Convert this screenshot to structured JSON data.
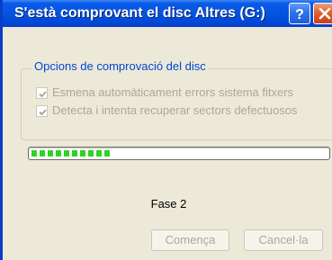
{
  "window": {
    "title": "S'està comprovant el disc Altres (G:)",
    "help_icon": "help-question-icon",
    "close_icon": "close-x-icon"
  },
  "options": {
    "group_title": "Opcions de comprovació del disc",
    "items": [
      {
        "label": "Esmena automàticament errors sistema fitxers",
        "checked": true,
        "enabled": false
      },
      {
        "label": "Detecta i intenta recuperar sectors defectuosos",
        "checked": true,
        "enabled": false
      }
    ]
  },
  "progress": {
    "fraction": 0.27,
    "color": "#2ed321"
  },
  "status": {
    "phase": "Fase 2"
  },
  "buttons": {
    "start_label": "Comença",
    "cancel_label": "Cancel·la"
  },
  "colors": {
    "titlebar": "#0455e0",
    "group_title": "#0046d5",
    "disabled_text": "#aca899",
    "dialog_bg": "#ece9d8"
  }
}
